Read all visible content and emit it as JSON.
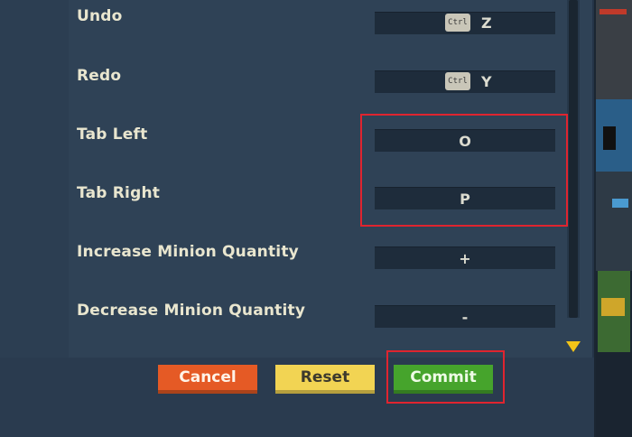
{
  "keybindings": [
    {
      "label": "Undo",
      "modifier": "Ctrl",
      "key": "Z"
    },
    {
      "label": "Redo",
      "modifier": "Ctrl",
      "key": "Y"
    },
    {
      "label": "Tab Left",
      "modifier": "",
      "key": "O"
    },
    {
      "label": "Tab Right",
      "modifier": "",
      "key": "P"
    },
    {
      "label": "Increase Minion Quantity",
      "modifier": "",
      "key": "+"
    },
    {
      "label": "Decrease Minion Quantity",
      "modifier": "",
      "key": "-"
    }
  ],
  "buttons": {
    "cancel": "Cancel",
    "reset": "Reset",
    "commit": "Commit"
  },
  "colors": {
    "panel": "#2f4256",
    "key_field": "#1e2c3b",
    "label_text": "#e9e6cf",
    "cancel": "#e55a25",
    "reset": "#f2d453",
    "commit": "#46a42c",
    "highlight": "#e0242f",
    "scroll_arrow": "#f2c418"
  },
  "icons": {
    "scroll_down": "triangle-down-icon"
  }
}
